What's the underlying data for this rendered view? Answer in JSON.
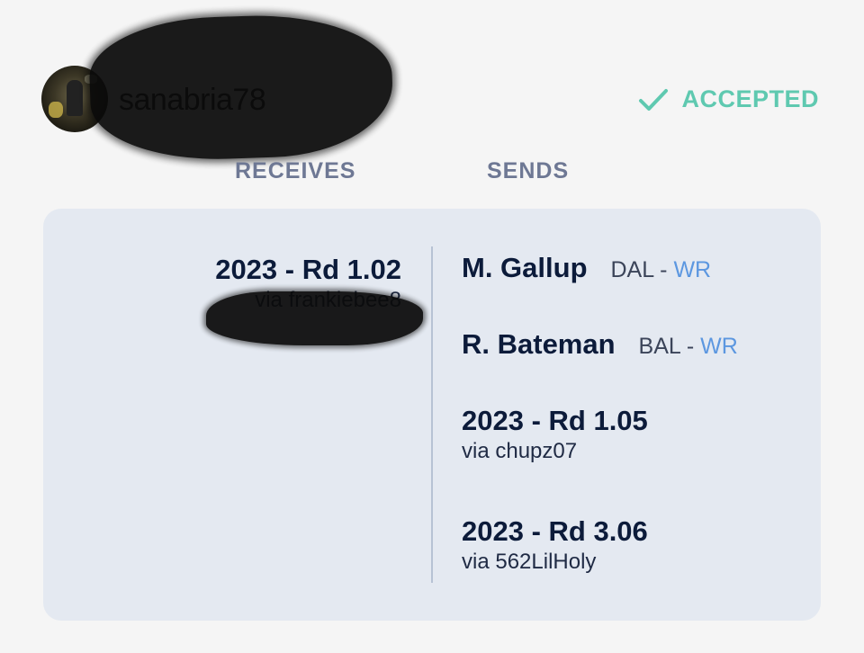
{
  "header": {
    "username": "sanabria78",
    "status": "ACCEPTED",
    "status_color": "#5fc9b0",
    "status_icon": "checkmark-icon"
  },
  "columns": {
    "receives": "RECEIVES",
    "sends": "SENDS"
  },
  "receives": [
    {
      "title": "2023 - Rd 1.02",
      "via": "via frankiebee8"
    }
  ],
  "sends": [
    {
      "name": "M. Gallup",
      "team": "DAL",
      "sep": "-",
      "position": "WR"
    },
    {
      "name": "R. Bateman",
      "team": "BAL",
      "sep": "-",
      "position": "WR"
    },
    {
      "title": "2023 - Rd 1.05",
      "via": "via chupz07"
    },
    {
      "title": "2023 - Rd 3.06",
      "via": "via 562LilHoly"
    }
  ]
}
